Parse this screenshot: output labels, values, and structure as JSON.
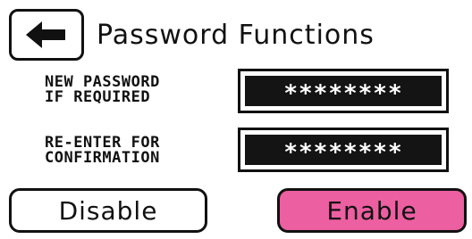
{
  "header": {
    "title": "Password Functions",
    "back_icon": "left-arrow-icon"
  },
  "fields": {
    "new_password": {
      "label_line1": "NEW PASSWORD",
      "label_line2": "IF REQUIRED",
      "value": "********"
    },
    "confirm_password": {
      "label_line1": "RE-ENTER FOR",
      "label_line2": "CONFIRMATION",
      "value": "********"
    }
  },
  "buttons": {
    "disable_label": "Disable",
    "enable_label": "Enable"
  },
  "colors": {
    "enable_button": "#ec5fa1",
    "field_fill": "#141414",
    "border": "#111111",
    "background": "#ffffff"
  }
}
